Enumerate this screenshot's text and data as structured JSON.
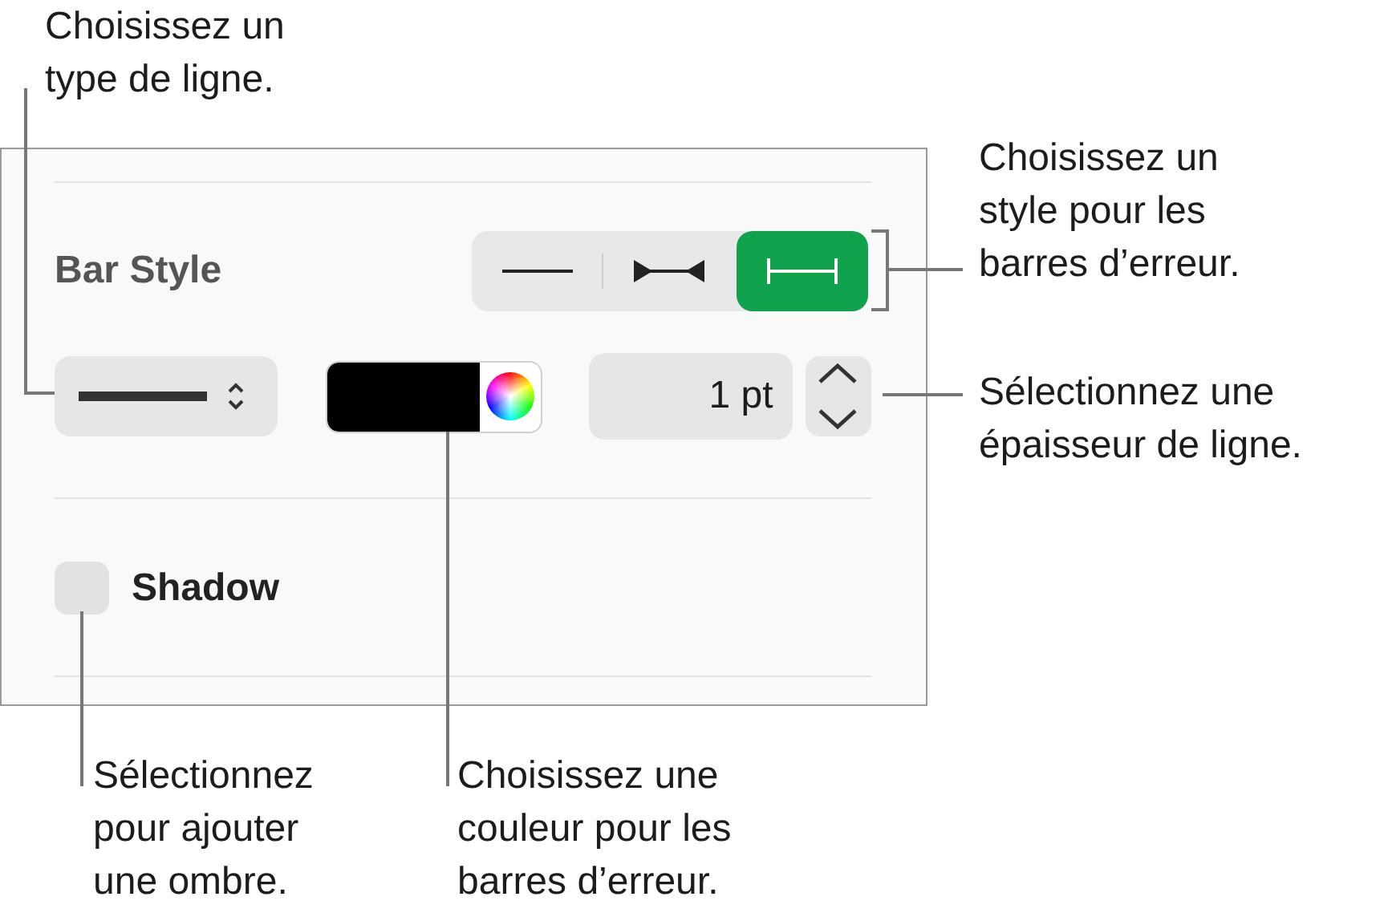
{
  "callouts": [
    {
      "text": "Choisissez un\ntype de ligne."
    },
    {
      "text": "Choisissez un\nstyle pour les\nbarres d’erreur."
    },
    {
      "text": "Sélectionnez une\népaisseur de ligne."
    },
    {
      "text": "Sélectionnez\npour ajouter\nune ombre."
    },
    {
      "text": "Choisissez une\ncouleur pour les\nbarres d’erreur."
    }
  ],
  "panel": {
    "section_label": "Bar Style",
    "bar_styles": [
      {
        "kind": "plain",
        "selected": false
      },
      {
        "kind": "inward",
        "selected": false
      },
      {
        "kind": "caps",
        "selected": true
      }
    ],
    "line_width": {
      "value": "1 pt"
    },
    "shadow": {
      "label": "Shadow",
      "checked": false
    }
  }
}
